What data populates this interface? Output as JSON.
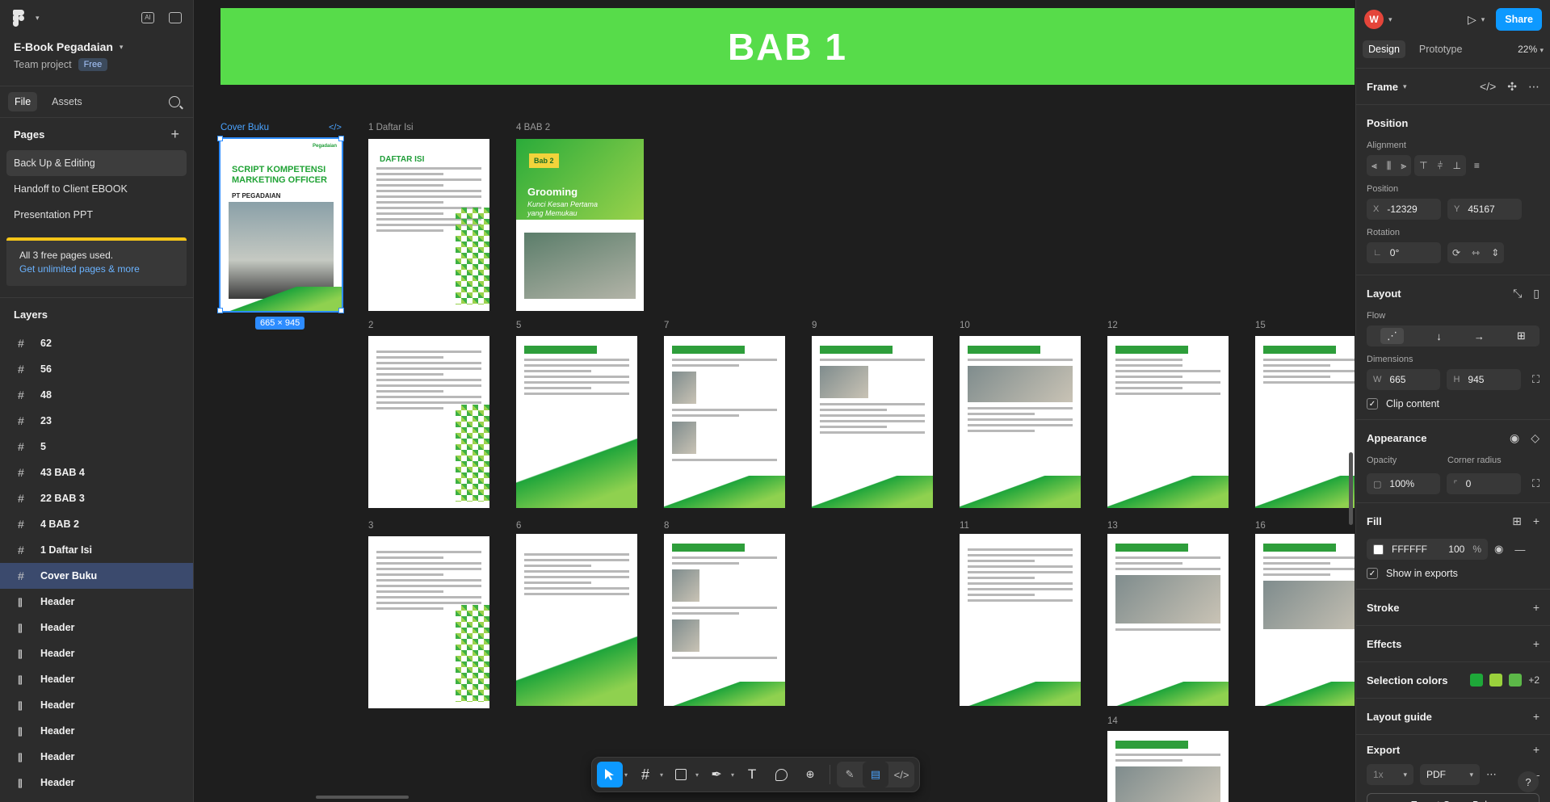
{
  "file": {
    "title": "E-Book Pegadaian",
    "team": "Team project",
    "plan": "Free"
  },
  "left_tabs": [
    "File",
    "Assets"
  ],
  "pages": {
    "heading": "Pages",
    "items": [
      "Back Up & Editing",
      "Handoff to Client EBOOK",
      "Presentation PPT"
    ],
    "selected": 0
  },
  "notice": {
    "text": "All 3 free pages used.",
    "link": "Get unlimited pages & more"
  },
  "layers": {
    "heading": "Layers",
    "items": [
      {
        "type": "frame",
        "name": "62"
      },
      {
        "type": "frame",
        "name": "56"
      },
      {
        "type": "frame",
        "name": "48"
      },
      {
        "type": "frame",
        "name": "23"
      },
      {
        "type": "frame",
        "name": "5"
      },
      {
        "type": "frame",
        "name": "43 BAB 4"
      },
      {
        "type": "frame",
        "name": "22 BAB 3"
      },
      {
        "type": "frame",
        "name": "4 BAB 2"
      },
      {
        "type": "frame",
        "name": "1 Daftar Isi"
      },
      {
        "type": "frame",
        "name": "Cover Buku",
        "selected": true
      },
      {
        "type": "header",
        "name": "Header"
      },
      {
        "type": "header",
        "name": "Header"
      },
      {
        "type": "header",
        "name": "Header"
      },
      {
        "type": "header",
        "name": "Header"
      },
      {
        "type": "header",
        "name": "Header"
      },
      {
        "type": "header",
        "name": "Header"
      },
      {
        "type": "header",
        "name": "Header"
      },
      {
        "type": "header",
        "name": "Header"
      }
    ]
  },
  "canvas": {
    "banner": "BAB 1",
    "frame_labels": {
      "cover": "Cover Buku",
      "toc": "1 Daftar Isi",
      "bab2": "4 BAB 2",
      "n2": "2",
      "n3": "3",
      "n5": "5",
      "n6": "6",
      "n7": "7",
      "n8": "8",
      "n9": "9",
      "n10": "10",
      "n11": "11",
      "n12": "12",
      "n13": "13",
      "n14": "14",
      "n15": "15",
      "n16": "16"
    },
    "selection_size": "665 × 945",
    "cover": {
      "title": "SCRIPT KOMPETENSI MARKETING OFFICER",
      "company": "PT PEGADAIAN",
      "logo": "Pegadaian"
    },
    "toc_title": "DAFTAR ISI",
    "bab2": {
      "tag": "Bab 2",
      "title": "Grooming",
      "subtitle": "Kunci Kesan Pertama yang Memukau"
    }
  },
  "toolbar": {
    "tools": [
      "move-tool",
      "frame-tool",
      "shape-tool",
      "pen-tool",
      "text-tool",
      "comment-tool",
      "actions-tool"
    ],
    "active": "move-tool"
  },
  "right": {
    "user_initial": "W",
    "share_label": "Share",
    "tabs": [
      "Design",
      "Prototype"
    ],
    "zoom": "22%",
    "frame_label": "Frame",
    "position": {
      "heading": "Position",
      "alignment_label": "Alignment",
      "position_label": "Position",
      "x_key": "X",
      "x": "-12329",
      "y_key": "Y",
      "y": "45167",
      "rotation_label": "Rotation",
      "rotation": "0°"
    },
    "layout": {
      "heading": "Layout",
      "flow_label": "Flow",
      "dimensions_label": "Dimensions",
      "w_key": "W",
      "w": "665",
      "h_key": "H",
      "h": "945",
      "clip": "Clip content"
    },
    "appearance": {
      "heading": "Appearance",
      "opacity_label": "Opacity",
      "opacity": "100%",
      "radius_label": "Corner radius",
      "radius": "0"
    },
    "fill": {
      "heading": "Fill",
      "hex": "FFFFFF",
      "opacity": "100",
      "pct": "%",
      "show_in_exports": "Show in exports",
      "color": "#FFFFFF"
    },
    "stroke": "Stroke",
    "effects": "Effects",
    "selection_colors": {
      "heading": "Selection colors",
      "colors": [
        "#1ea839",
        "#9ad13c",
        "#5cb848"
      ],
      "more": "+2"
    },
    "layout_guide": "Layout guide",
    "export": {
      "heading": "Export",
      "scale": "1x",
      "format": "PDF",
      "button": "Export Cover Buku"
    }
  },
  "colors": {
    "accent": "#0d99ff",
    "banner": "#57dc4a",
    "brand_green": "#1f9d38"
  }
}
